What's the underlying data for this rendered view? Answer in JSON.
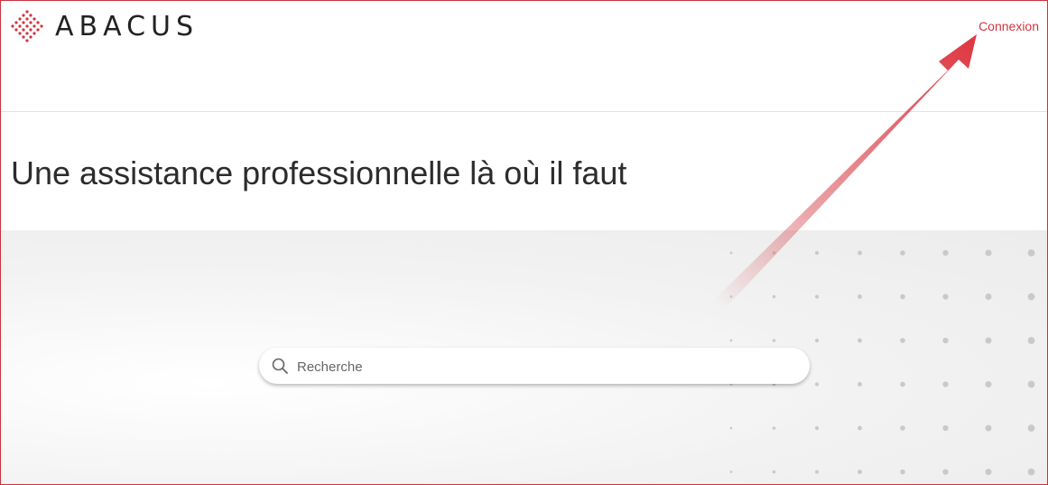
{
  "header": {
    "brand": "ABACUS",
    "login_label": "Connexion"
  },
  "main": {
    "headline": "Une assistance professionnelle là où il faut"
  },
  "search": {
    "placeholder": "Recherche",
    "value": ""
  },
  "icons": {
    "logo": "abacus-diamond-dots-icon",
    "search": "magnifier-icon"
  },
  "colors": {
    "accent": "#d0343e",
    "text": "#2c2c2c",
    "hero_bg": "#efefef"
  }
}
